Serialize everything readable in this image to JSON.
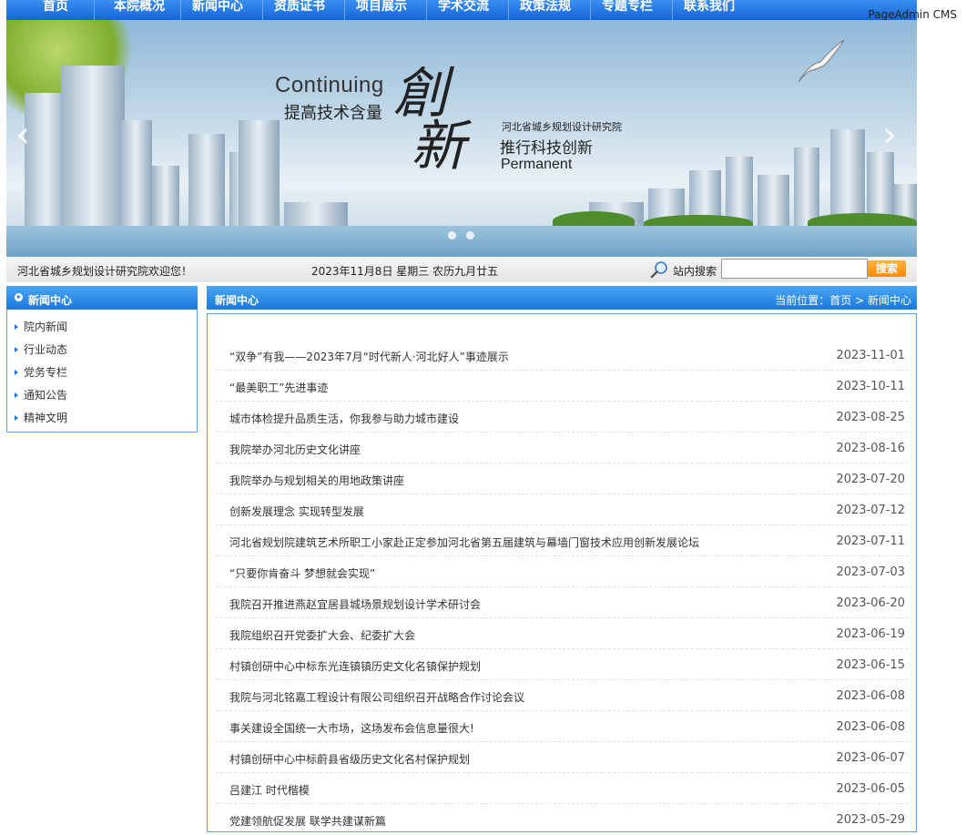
{
  "nav": {
    "items": [
      "首页",
      "本院概况",
      "新闻中心",
      "资质证书",
      "项目展示",
      "学术交流",
      "政策法规",
      "专题专栏",
      "联系我们"
    ],
    "brand": "PageAdmin CMS"
  },
  "banner": {
    "continuing": "Continuing",
    "line1": "提高技术含量",
    "calligraphy": "創\n新",
    "institute": "河北省城乡规划设计研究院",
    "line2": "推行科技创新",
    "permanent": "Permanent",
    "prev_icon": "chevron-left-icon",
    "next_icon": "chevron-right-icon"
  },
  "infobar": {
    "welcome": "河北省城乡规划设计研究院欢迎您！",
    "date": "2023年11月8日 星期三  农历九月廿五",
    "search_label": "站内搜索",
    "search_value": "",
    "search_button": "搜索"
  },
  "sidebar": {
    "title": "新闻中心",
    "items": [
      "院内新闻",
      "行业动态",
      "党务专栏",
      "通知公告",
      "精神文明"
    ]
  },
  "main": {
    "title": "新闻中心",
    "breadcrumb": {
      "prefix": "当前位置：",
      "home": "首页",
      "sep": " > ",
      "current": "新闻中心"
    },
    "news": [
      {
        "title": "“双争”有我——2023年7月“时代新人·河北好人”事迹展示",
        "date": "2023-11-01"
      },
      {
        "title": "“最美职工”先进事迹",
        "date": "2023-10-11"
      },
      {
        "title": "城市体检提升品质生活，你我参与助力城市建设",
        "date": "2023-08-25"
      },
      {
        "title": "我院举办河北历史文化讲座",
        "date": "2023-08-16"
      },
      {
        "title": "我院举办与规划相关的用地政策讲座",
        "date": "2023-07-20"
      },
      {
        "title": "创新发展理念 实现转型发展",
        "date": "2023-07-12"
      },
      {
        "title": "河北省规划院建筑艺术所职工小家赴正定参加河北省第五届建筑与幕墙门窗技术应用创新发展论坛",
        "date": "2023-07-11"
      },
      {
        "title": "“只要你肯奋斗 梦想就会实现”",
        "date": "2023-07-03"
      },
      {
        "title": "我院召开推进燕赵宜居县城场景规划设计学术研讨会",
        "date": "2023-06-20"
      },
      {
        "title": "我院组织召开党委扩大会、纪委扩大会",
        "date": "2023-06-19"
      },
      {
        "title": "村镇创研中心中标东光连镇镇历史文化名镇保护规划",
        "date": "2023-06-15"
      },
      {
        "title": "我院与河北铭嘉工程设计有限公司组织召开战略合作讨论会议",
        "date": "2023-06-08"
      },
      {
        "title": "事关建设全国统一大市场，这场发布会信息量很大!",
        "date": "2023-06-08"
      },
      {
        "title": "村镇创研中心中标蔚县省级历史文化名村保护规划",
        "date": "2023-06-07"
      },
      {
        "title": "吕建江 时代楷模",
        "date": "2023-06-05"
      },
      {
        "title": "党建领航促发展  联学共建谋新篇",
        "date": "2023-05-29"
      }
    ]
  }
}
